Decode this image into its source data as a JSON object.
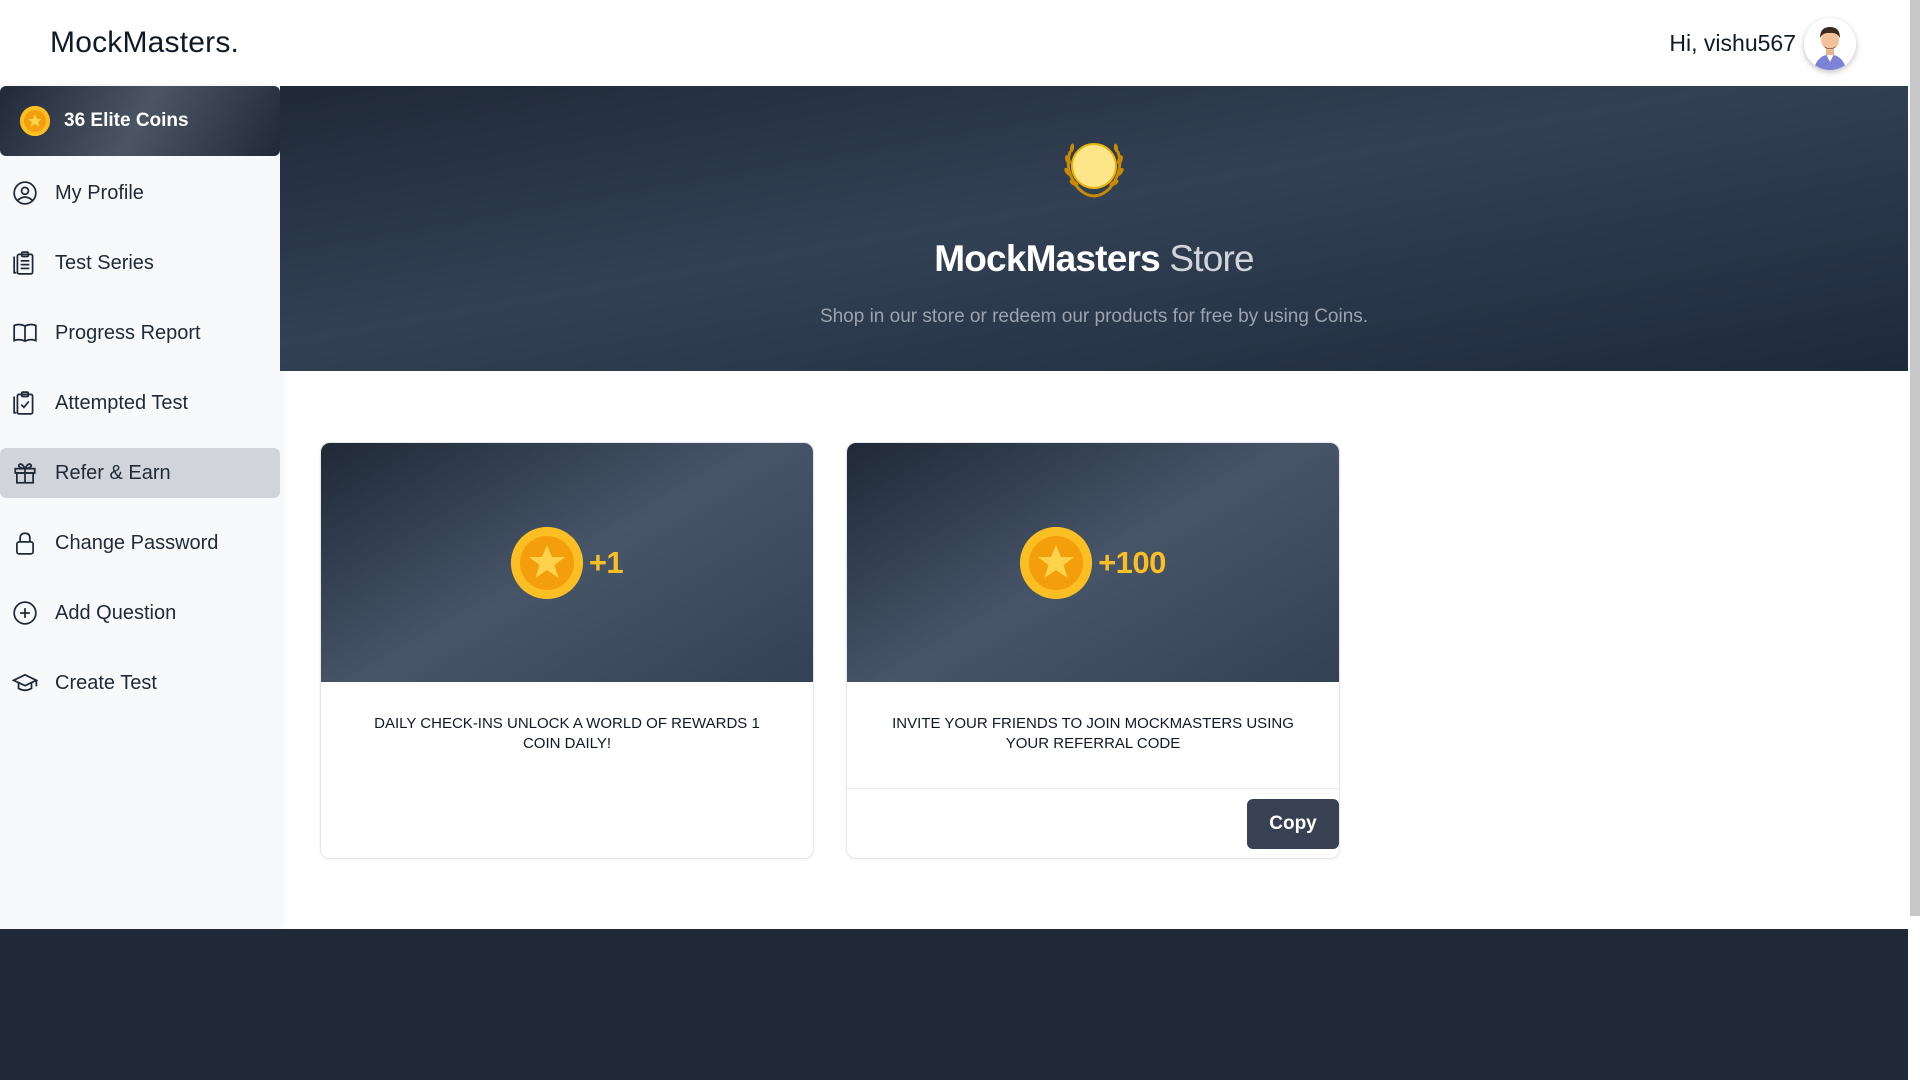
{
  "header": {
    "logo": "MockMasters.",
    "greeting": "Hi, vishu567"
  },
  "loading": {
    "progress": 0.2
  },
  "sidebar": {
    "coins_label": "36 Elite Coins",
    "items": [
      {
        "label": "My Profile",
        "icon": "user-circle-icon",
        "active": false
      },
      {
        "label": "Test Series",
        "icon": "clipboard-list-icon",
        "active": false
      },
      {
        "label": "Progress Report",
        "icon": "book-open-icon",
        "active": false
      },
      {
        "label": "Attempted Test",
        "icon": "clipboard-check-icon",
        "active": false
      },
      {
        "label": "Refer & Earn",
        "icon": "gift-icon",
        "active": true
      },
      {
        "label": "Change Password",
        "icon": "lock-icon",
        "active": false
      },
      {
        "label": "Add Question",
        "icon": "plus-circle-icon",
        "active": false
      },
      {
        "label": "Create Test",
        "icon": "graduation-cap-icon",
        "active": false
      }
    ]
  },
  "hero": {
    "title_bold": "MockMasters",
    "title_light": " Store",
    "subtitle": "Shop in our store or redeem our products for free by using Coins."
  },
  "cards": [
    {
      "reward": "+1",
      "description": "DAILY CHECK-INS UNLOCK A WORLD OF REWARDS 1 COIN DAILY!"
    },
    {
      "reward": "+100",
      "description": "INVITE YOUR FRIENDS TO JOIN MOCKMASTERS USING YOUR REFERRAL CODE",
      "button_label": "Copy"
    }
  ],
  "colors": {
    "accent_gold": "#fbbf24",
    "dark_slate": "#1f2937",
    "active_nav": "#d1d5db",
    "button": "#374151"
  }
}
